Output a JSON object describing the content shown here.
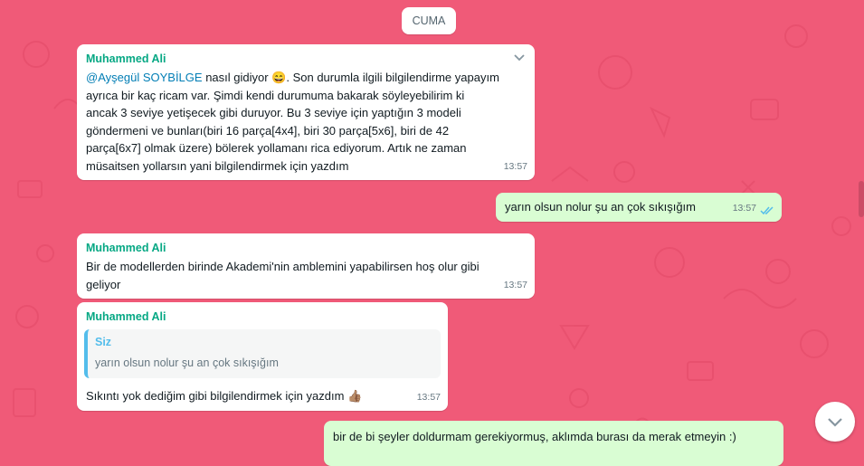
{
  "date_divider": "CUMA",
  "messages": [
    {
      "sender": "Muhammed Ali",
      "mention": "@Ayşegül SOYBİLGE",
      "text_after_mention": " nasıl gidiyor ",
      "emoji": "😄",
      "line1_rest": ". Son durumla ilgili bilgilendirme yapayım",
      "line2": "ayrıca bir kaç ricam var. Şimdi kendi durumuma bakarak söyleyebilirim ki",
      "line3": "ancak 3 seviye yetişecek gibi duruyor. Bu 3 seviye için yaptığın 3 modeli",
      "line4": "göndermeni ve bunları(biri 16 parça[4x4], biri 30 parça[5x6], biri de 42",
      "line5": "parça[6x7] olmak üzere) bölerek yollamanı rica ediyorum. Artık ne zaman",
      "line6": "müsaitsen yollarsın yani bilgilendirmek için yazdım",
      "time": "13:57"
    },
    {
      "text": "yarın olsun nolur şu an çok sıkışığım",
      "time": "13:57"
    },
    {
      "sender": "Muhammed Ali",
      "line1": "Bir de modellerden birinde Akademi'nin amblemini yapabilirsen hoş olur gibi",
      "line2": "geliyor",
      "time": "13:57"
    },
    {
      "sender": "Muhammed Ali",
      "quote_author": "Siz",
      "quote_text": "yarın olsun nolur şu an çok sıkışığım",
      "text": "Sıkıntı yok dediğim gibi bilgilendirmek için yazdım ",
      "emoji": "👍🏽",
      "time": "13:57"
    },
    {
      "text": "bir de bi şeyler doldurmam gerekiyormuş, aklımda burası da merak etmeyin :)"
    }
  ],
  "icons": {
    "chevron": "chevron-down-icon",
    "read_receipt": "double-check-icon",
    "scroll_down": "scroll-down-icon"
  },
  "colors": {
    "background": "#f05a78",
    "incoming_bubble": "#ffffff",
    "outgoing_bubble": "#d9fdd3",
    "sender_name": "#06a884",
    "mention": "#027eb5",
    "read_ticks": "#53bdeb"
  }
}
